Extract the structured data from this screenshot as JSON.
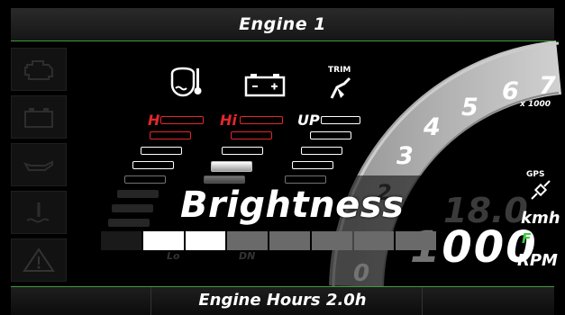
{
  "header": {
    "title": "Engine 1"
  },
  "footer": {
    "engine_hours": "Engine Hours 2.0h"
  },
  "sidebar": {
    "items": [
      {
        "icon": "engine-check-icon"
      },
      {
        "icon": "battery-icon"
      },
      {
        "icon": "oil-can-icon"
      },
      {
        "icon": "coolant-temp-icon"
      },
      {
        "icon": "warning-triangle-icon"
      }
    ]
  },
  "gauges": {
    "temp": {
      "icon": "engine-temp-icon",
      "label": "H"
    },
    "battery": {
      "icon": "battery-icon",
      "label": "Hi"
    },
    "trim": {
      "icon": "trim-icon",
      "label": "UP",
      "icon_label": "TRIM"
    },
    "trim_dn_label": "DN",
    "lo_label": "Lo"
  },
  "tachometer": {
    "ticks": [
      "3",
      "4",
      "5",
      "6",
      "7"
    ],
    "multiplier": "x 1000",
    "zero": "0",
    "partial_two": "2"
  },
  "speed": {
    "value": "18.0",
    "unit": "kmh",
    "gps_label": "GPS"
  },
  "rpm": {
    "value": "1000",
    "unit": "RPM",
    "flag": "F"
  },
  "brightness": {
    "label": "Brightness",
    "segments_total": 7,
    "segments_on": 2
  },
  "colors": {
    "accent": "#3c9a3c",
    "warning": "#e3262d"
  }
}
